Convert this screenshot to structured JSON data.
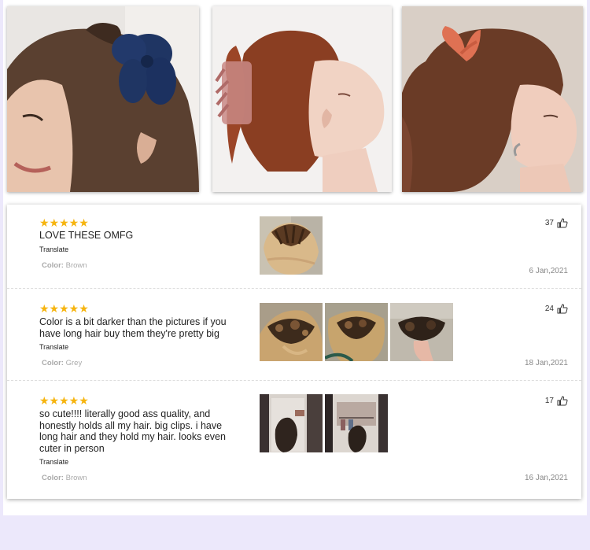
{
  "photos": [
    {
      "icon": "woman-navy-flower-claw-clip-photo"
    },
    {
      "icon": "woman-pink-claw-clip-photo"
    },
    {
      "icon": "woman-coral-claw-clip-photo"
    }
  ],
  "star_color": "#f6b40e",
  "reviews": [
    {
      "stars": "★★★★★",
      "rating": 5,
      "text": "LOVE THESE OMFG",
      "translate": "Translate",
      "color_key": "Color:",
      "color_value": "Brown",
      "likes": "37",
      "date": "6 Jan,2021",
      "photos": [
        "customer-photo-brown-clip"
      ]
    },
    {
      "stars": "★★★★★",
      "rating": 5,
      "text": "Color is a bit darker than the pictures if you have long hair buy them they're pretty big",
      "translate": "Translate",
      "color_key": "Color:",
      "color_value": "Grey",
      "likes": "24",
      "date": "18 Jan,2021",
      "photos": [
        "customer-photo-tortoise-clip-1",
        "customer-photo-tortoise-clip-2",
        "customer-photo-clip-in-hand"
      ]
    },
    {
      "stars": "★★★★★",
      "rating": 5,
      "text": "so cute!!!! literally good ass quality, and honestly holds all my hair. big clips. i have long hair and they hold my hair. looks even cuter in person",
      "translate": "Translate",
      "color_key": "Color:",
      "color_value": "Brown",
      "likes": "17",
      "date": "16 Jan,2021",
      "photos": [
        "customer-photo-mirror-selfie-1",
        "customer-photo-mirror-selfie-2"
      ]
    }
  ]
}
